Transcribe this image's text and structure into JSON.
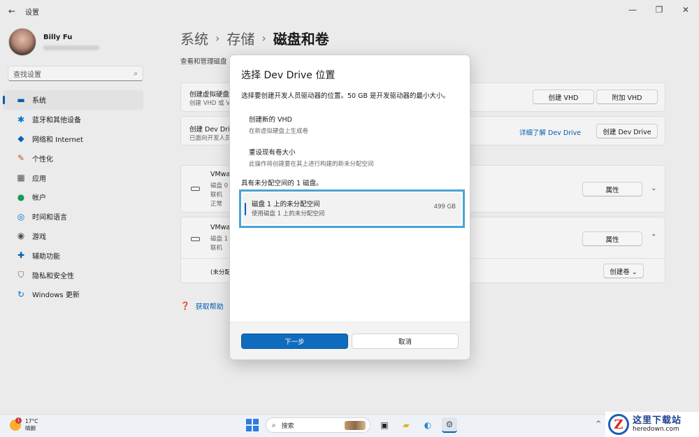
{
  "window": {
    "title": "设置",
    "back_icon": "back-arrow-icon",
    "controls": [
      "—",
      "❐",
      "✕"
    ]
  },
  "user": {
    "name": "Billy Fu"
  },
  "search": {
    "placeholder": "查找设置",
    "icon": "search-icon"
  },
  "nav": [
    {
      "label": "系统",
      "icon": "monitor-icon",
      "active": true,
      "color": "#0063b1"
    },
    {
      "label": "蓝牙和其他设备",
      "icon": "bluetooth-icon",
      "color": "#0078d4"
    },
    {
      "label": "网络和 Internet",
      "icon": "wifi-icon",
      "color": "#0067c0"
    },
    {
      "label": "个性化",
      "icon": "brush-icon",
      "color": "#c55a11"
    },
    {
      "label": "应用",
      "icon": "apps-icon",
      "color": "#555555"
    },
    {
      "label": "帐户",
      "icon": "person-icon",
      "color": "#1e9e5a"
    },
    {
      "label": "时间和语言",
      "icon": "globe-clock-icon",
      "color": "#0078d4"
    },
    {
      "label": "游戏",
      "icon": "gamepad-icon",
      "color": "#555555"
    },
    {
      "label": "辅助功能",
      "icon": "accessibility-icon",
      "color": "#0063b1"
    },
    {
      "label": "隐私和安全性",
      "icon": "shield-icon",
      "color": "#6b6b6b"
    },
    {
      "label": "Windows 更新",
      "icon": "update-icon",
      "color": "#0078d4"
    }
  ],
  "main": {
    "breadcrumb": [
      "系统",
      "存储",
      "磁盘和卷"
    ],
    "breadcrumb_sep": "›",
    "description": "查看和管理磁盘",
    "vhd": {
      "title": "创建虚拟硬盘",
      "subtitle": "创建 VHD 或 V",
      "create": "创建 VHD",
      "attach": "附加 VHD"
    },
    "devdrive": {
      "title": "创建 Dev Driv",
      "subtitle": "已面向开发人员",
      "link": "详细了解 Dev Drive",
      "button": "创建 Dev Drive"
    },
    "disk0": {
      "name": "VMwa",
      "line1": "磁盘 0",
      "line2": "联机",
      "line3": "正常",
      "button": "属性",
      "chevron": "⌄"
    },
    "disk1": {
      "name": "VMwa",
      "line1": "磁盘 1",
      "line2": "联机",
      "button": "属性",
      "chevron": "⌃",
      "unalloc": "(未分配",
      "create_volume": "创建卷 ⌄"
    },
    "help": "获取帮助"
  },
  "dialog": {
    "title": "选择 Dev Drive 位置",
    "subtitle": "选择要创建开发人员驱动器的位置。50 GB 是开发驱动器的最小大小。",
    "options": [
      {
        "title": "创建新的 VHD",
        "subtitle": "在新虚拟硬盘上生成卷"
      },
      {
        "title": "重设现有卷大小",
        "subtitle": "此操作将创建要在其上进行构建的新未分配空间"
      }
    ],
    "section": "具有未分配空间的 1 磁盘。",
    "selected": {
      "title": "磁盘 1 上的未分配空间",
      "subtitle": "使用磁盘 1 上的未分配空间",
      "size": "499 GB"
    },
    "next": "下一步",
    "cancel": "取消",
    "accent": "#0f6cbd",
    "highlight": "#4aa3d8"
  },
  "taskbar": {
    "weather": {
      "badge": "1",
      "temp": "17°C",
      "condition": "晴朗"
    },
    "search_label": "搜索",
    "apps": [
      "task-view-icon",
      "file-explorer-icon",
      "edge-icon",
      "settings-icon"
    ],
    "tray_chevron": "^"
  },
  "watermark": {
    "glyph": "Z",
    "title": "这里下载站",
    "url": "heredown.com"
  }
}
